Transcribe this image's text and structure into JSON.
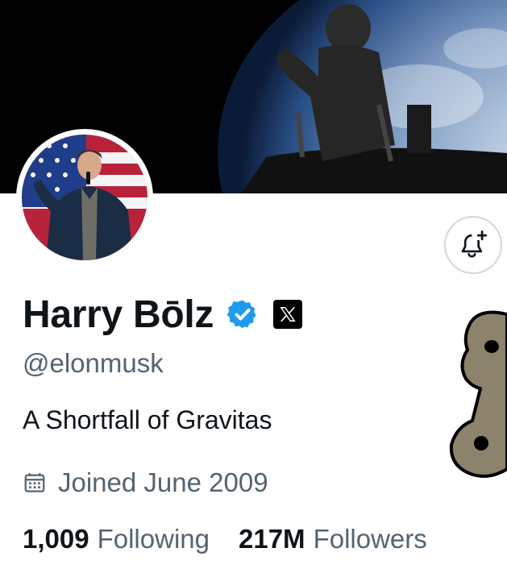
{
  "profile": {
    "display_name": "Harry Bōlz",
    "handle": "@elonmusk",
    "bio": "A Shortfall of Gravitas",
    "joined": "Joined June 2009",
    "verified": true
  },
  "stats": {
    "following_count": "1,009",
    "following_label": "Following",
    "followers_count": "217M",
    "followers_label": "Followers"
  },
  "icons": {
    "notify": "bell-plus-icon",
    "verified": "verified-check-icon",
    "affiliate": "x-logo-icon",
    "calendar": "calendar-icon"
  },
  "colors": {
    "verified_blue": "#1d9bf0",
    "secondary_text": "#536471",
    "primary_text": "#0f1419"
  }
}
